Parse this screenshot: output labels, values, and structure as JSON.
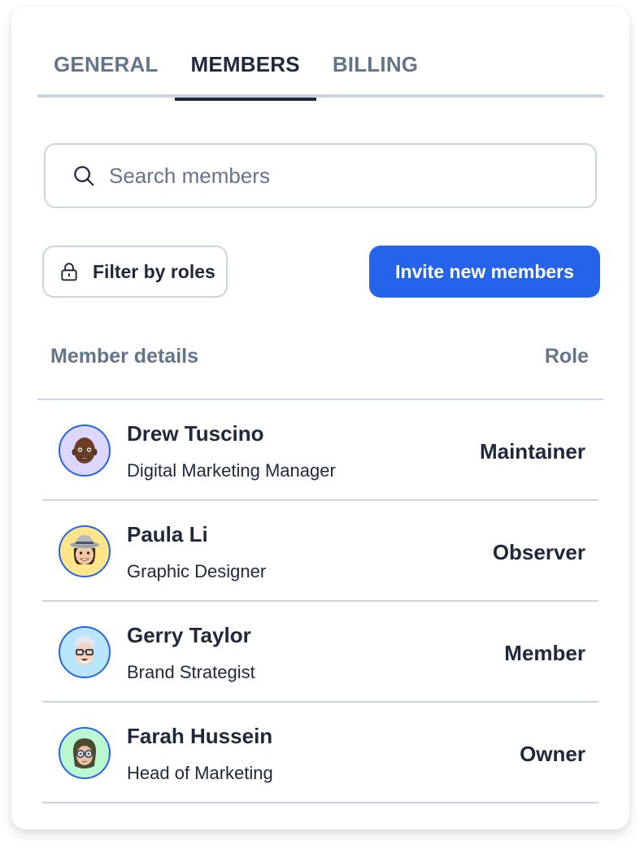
{
  "tabs": [
    {
      "label": "GENERAL",
      "active": false
    },
    {
      "label": "MEMBERS",
      "active": true
    },
    {
      "label": "BILLING",
      "active": false
    }
  ],
  "search": {
    "icon": "search-icon",
    "placeholder": "Search members",
    "value": ""
  },
  "filter_button": {
    "icon": "lock-icon",
    "label": "Filter by roles"
  },
  "invite_button": {
    "label": "Invite new members",
    "color": "#2563eb"
  },
  "table": {
    "columns": [
      "Member details",
      "Role"
    ],
    "rows": [
      {
        "name": "Drew Tuscino",
        "title": "Digital Marketing Manager",
        "role": "Maintainer",
        "avatar": "memoji-drew",
        "avatar_bg": "#ddd6fe"
      },
      {
        "name": "Paula Li",
        "title": "Graphic Designer",
        "role": "Observer",
        "avatar": "memoji-paula",
        "avatar_bg": "#fde68a"
      },
      {
        "name": "Gerry Taylor",
        "title": "Brand Strategist",
        "role": "Member",
        "avatar": "memoji-gerry",
        "avatar_bg": "#bae6fd"
      },
      {
        "name": "Farah Hussein",
        "title": "Head of Marketing",
        "role": "Owner",
        "avatar": "memoji-farah",
        "avatar_bg": "#bbf7d0"
      }
    ]
  }
}
